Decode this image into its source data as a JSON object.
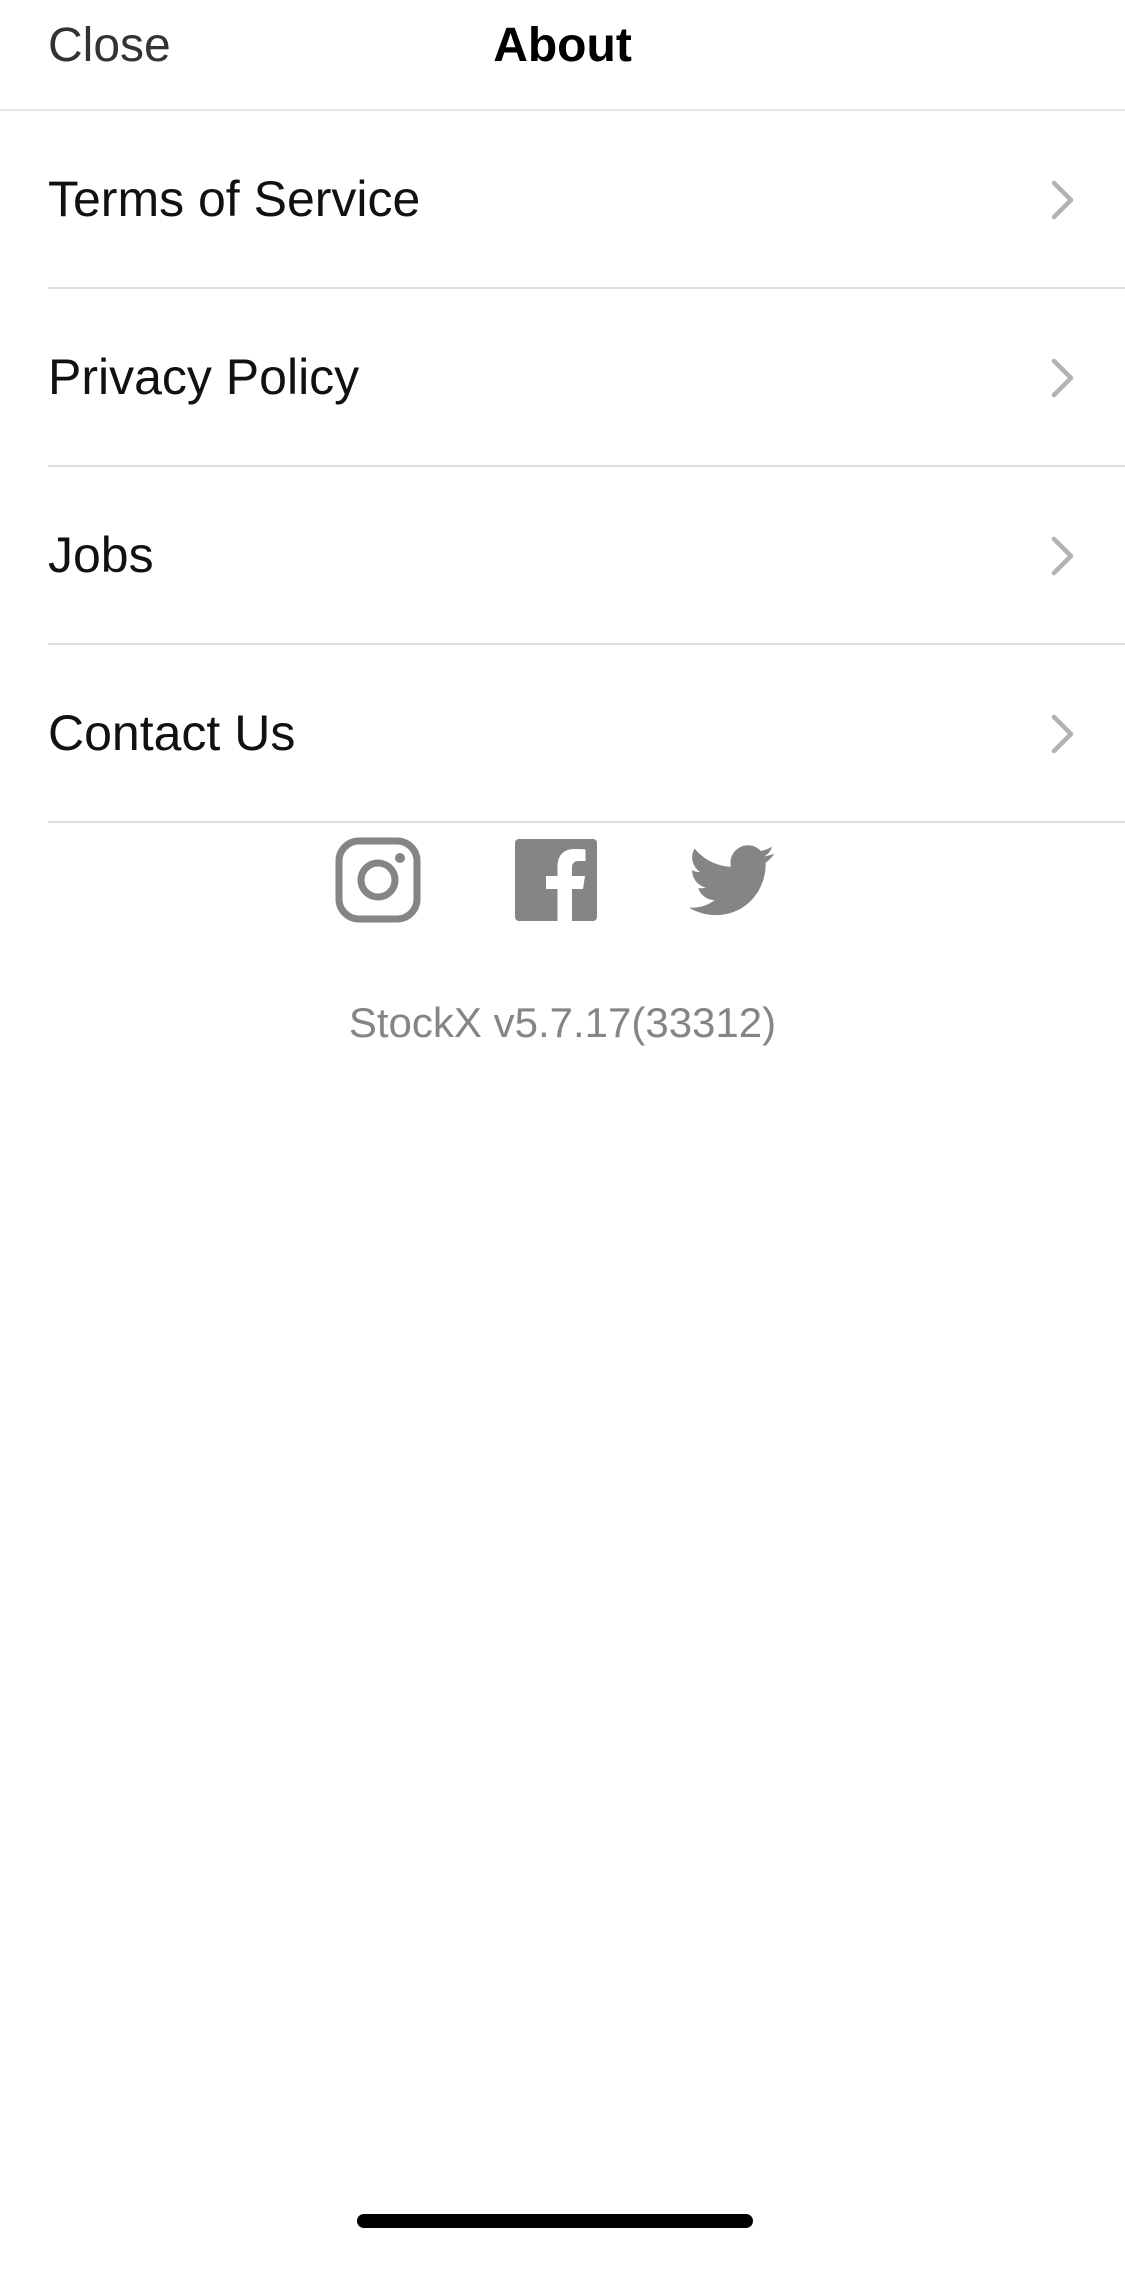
{
  "nav": {
    "close_label": "Close",
    "title": "About"
  },
  "menu": {
    "items": [
      {
        "label": "Terms of Service",
        "icon": "chevron-right-icon"
      },
      {
        "label": "Privacy Policy",
        "icon": "chevron-right-icon"
      },
      {
        "label": "Jobs",
        "icon": "chevron-right-icon"
      },
      {
        "label": "Contact Us",
        "icon": "chevron-right-icon"
      }
    ]
  },
  "social": {
    "icons": [
      "instagram-icon",
      "facebook-icon",
      "twitter-icon"
    ],
    "color": "#858585"
  },
  "footer": {
    "version": "StockX v5.7.17(33312)"
  },
  "colors": {
    "text": "#111111",
    "secondary_text": "#858585",
    "divider": "#dcdcdc",
    "chevron": "#b3b3b3"
  }
}
